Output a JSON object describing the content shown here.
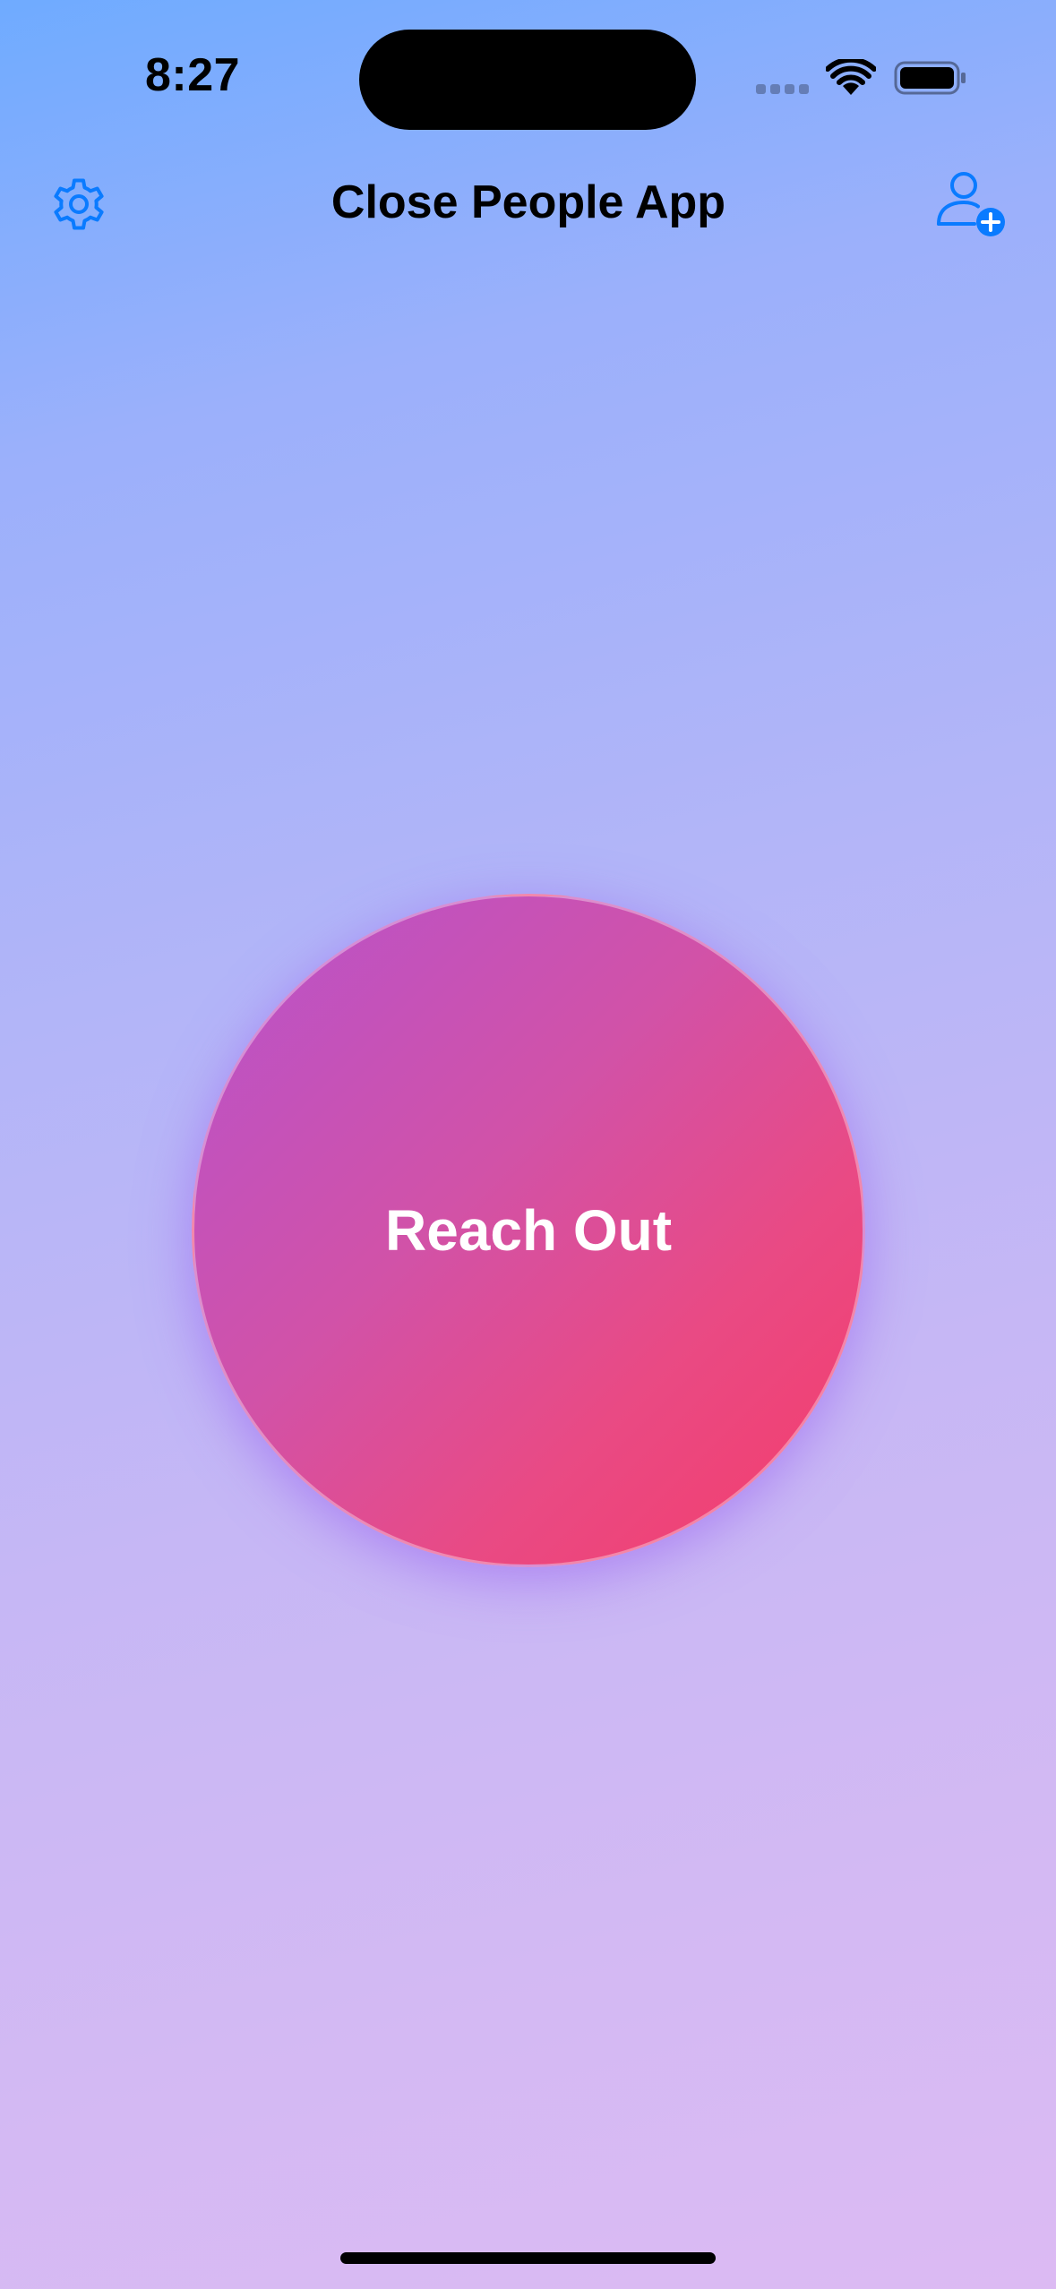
{
  "status_bar": {
    "time": "8:27"
  },
  "nav": {
    "title": "Close People App",
    "settings_icon": "gear-icon",
    "add_person_icon": "person-add-icon"
  },
  "main": {
    "reach_out_label": "Reach Out"
  },
  "colors": {
    "accent": "#0a7bff",
    "button_gradient_start": "#b653cd",
    "button_gradient_end": "#f53c6a",
    "background_top": "#6fabff",
    "background_bottom": "#dcbaf3"
  }
}
